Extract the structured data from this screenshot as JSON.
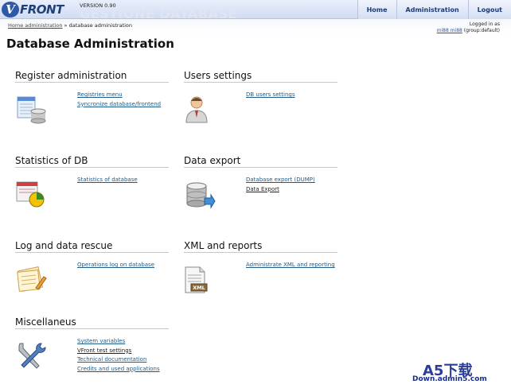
{
  "header": {
    "logo_letter": "V",
    "logo_text": "FRONT",
    "version": "VERSION 0.90",
    "watermark": "GESTIONE DATABASE",
    "nav": [
      "Home",
      "Administration",
      "Logout"
    ]
  },
  "breadcrumb": {
    "home": "Home administration",
    "separator": " » ",
    "current": "database administration"
  },
  "login": {
    "line1": "Logged in as",
    "user": "mi88 mi88",
    "group": " (group:default)"
  },
  "page_title": "Database Administration",
  "sections": [
    {
      "title": "Register administration",
      "icon": "registry-database-icon",
      "links": [
        "Registries menu",
        "Syncronize database/frontend"
      ]
    },
    {
      "title": "Users settings",
      "icon": "user-icon",
      "links": [
        "DB users settings"
      ]
    },
    {
      "title": "Statistics of DB",
      "icon": "statistics-chart-icon",
      "links": [
        "Statistics of database"
      ]
    },
    {
      "title": "Data export",
      "icon": "database-export-icon",
      "links": [
        "Database export (DUMP)",
        "Data Export"
      ]
    },
    {
      "title": "Log and data rescue",
      "icon": "log-notes-icon",
      "links": [
        "Operations log on database"
      ]
    },
    {
      "title": "XML and reports",
      "icon": "xml-document-icon",
      "links": [
        "Administrate XML and reporting"
      ]
    },
    {
      "title": "Miscellaneus",
      "icon": "tools-icon",
      "links": [
        "System variables",
        "VFront test settings",
        "Technical documentation",
        "Credits and used applications"
      ]
    }
  ],
  "footer_watermark": {
    "brand": "A5",
    "brand_cn": "下载",
    "url": "Down.admin5.com"
  },
  "colors": {
    "link": "#1f5a86",
    "header_blue": "#2d5aa8",
    "nav_text": "#1c3b78"
  }
}
